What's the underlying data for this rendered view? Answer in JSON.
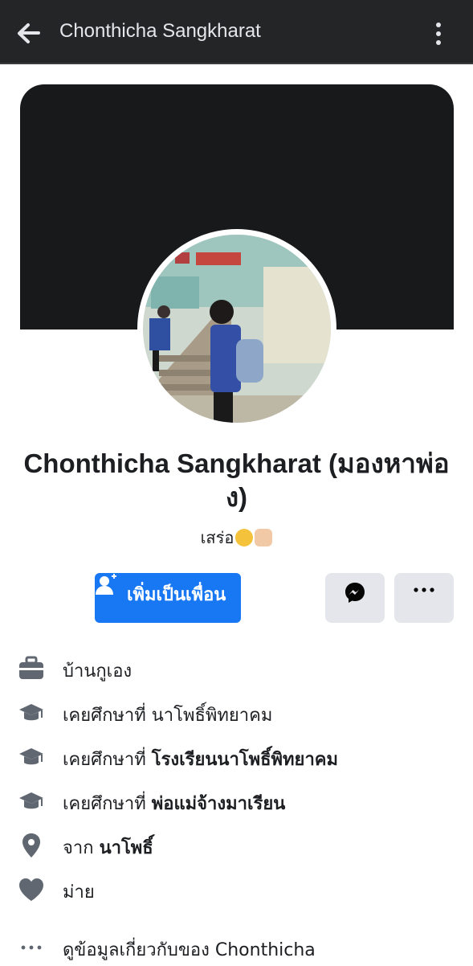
{
  "topbar": {
    "title": "Chonthicha Sangkharat"
  },
  "profile": {
    "name": "Chonthicha Sangkharat (มองหาพ่อง)",
    "bio_text": "เสร่อ",
    "bio_emojis": [
      "unamused-face-emoji",
      "fist-bump-emoji"
    ]
  },
  "actions": {
    "add_friend_label": "เพิ่มเป็นเพื่อน",
    "accent_color": "#1877f2"
  },
  "info": [
    {
      "icon": "briefcase-icon",
      "prefix": "บ้านกูเอง",
      "bold": ""
    },
    {
      "icon": "graduation-cap-icon",
      "prefix": "เคยศึกษาที่ ",
      "bold": "",
      "plain": "นาโพธิ์พิทยาคม"
    },
    {
      "icon": "graduation-cap-icon",
      "prefix": "เคยศึกษาที่ ",
      "bold": "โรงเรียนนาโพธิ์พิทยาคม"
    },
    {
      "icon": "graduation-cap-icon",
      "prefix": "เคยศึกษาที่ ",
      "bold": "พ่อแม่จ้างมาเรียน"
    },
    {
      "icon": "location-pin-icon",
      "prefix": "จาก ",
      "bold": "นาโพธิ์"
    },
    {
      "icon": "heart-icon",
      "prefix": "ม่าย",
      "bold": ""
    },
    {
      "icon": "more-dots-icon",
      "prefix": "ดูข้อมูลเกี่ยวกับของ Chonthicha",
      "bold": ""
    }
  ]
}
